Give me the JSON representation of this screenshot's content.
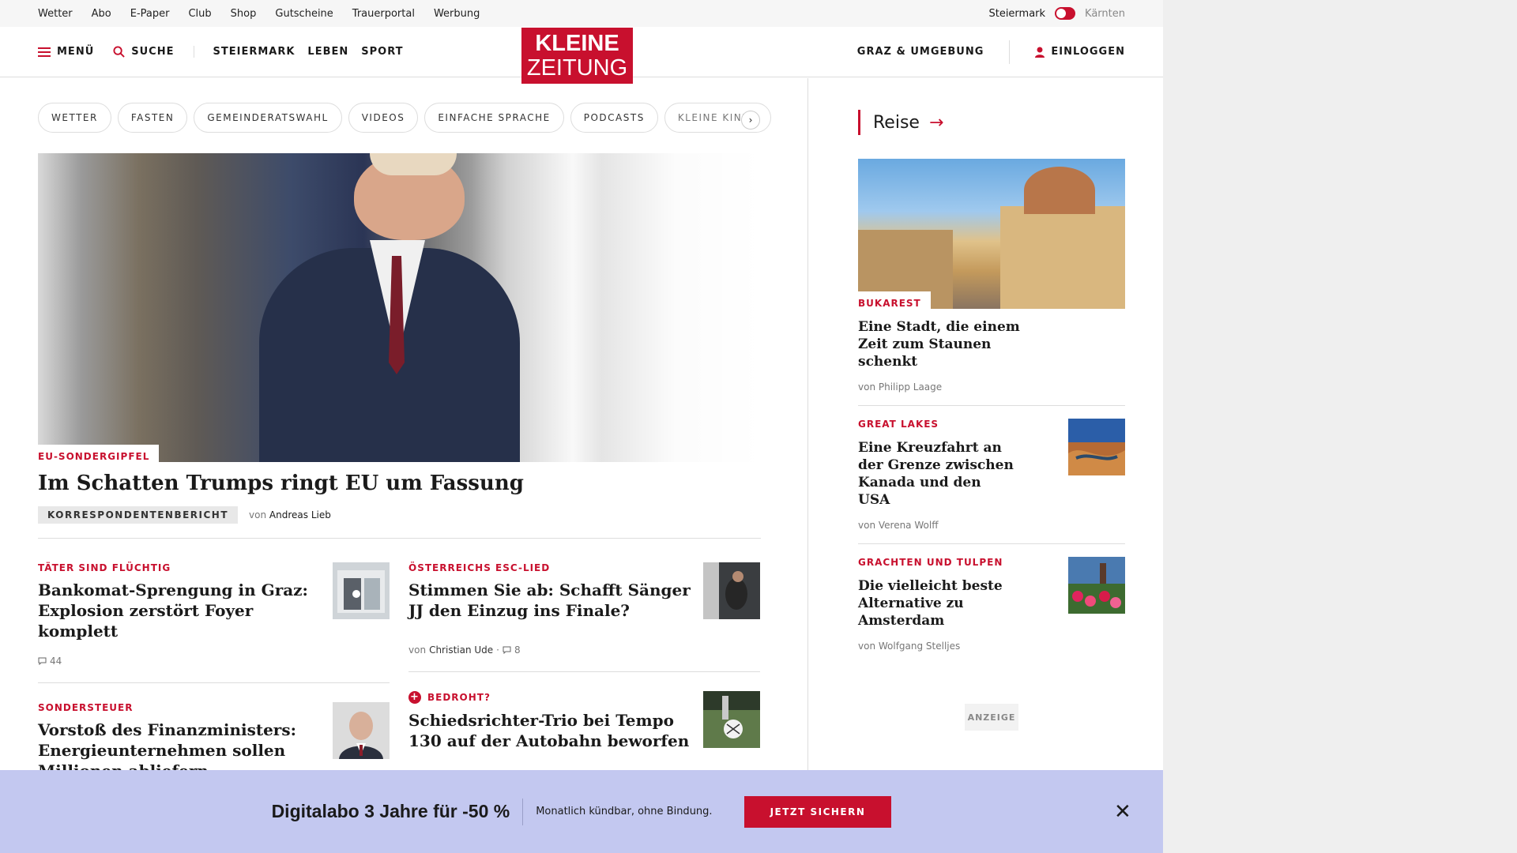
{
  "topbar": {
    "links": [
      "Wetter",
      "Abo",
      "E-Paper",
      "Club",
      "Shop",
      "Gutscheine",
      "Trauerportal",
      "Werbung"
    ],
    "region_active": "Steiermark",
    "region_inactive": "Kärnten"
  },
  "header": {
    "menu": "MENÜ",
    "search": "SUCHE",
    "nav": [
      "STEIERMARK",
      "LEBEN",
      "SPORT"
    ],
    "logo_line1": "KLEINE",
    "logo_line2": "ZEITUNG",
    "region_link": "GRAZ & UMGEBUNG",
    "login": "EINLOGGEN"
  },
  "chips": [
    "WETTER",
    "FASTEN",
    "GEMEINDERATSWAHL",
    "VIDEOS",
    "EINFACHE SPRACHE",
    "PODCASTS",
    "KLEINE KINDE"
  ],
  "hero": {
    "kicker": "EU-SONDERGIPFEL",
    "title": "Im Schatten Trumps ringt EU um Fassung",
    "badge": "KORRESPONDENTENBERICHT",
    "by_prefix": "von",
    "author": "Andreas Lieb"
  },
  "articles": {
    "a1": {
      "kicker": "TÄTER SIND FLÜCHTIG",
      "title": "Bankomat-Sprengung in Graz: Explosion zerstört Foyer komplett",
      "comments": "44"
    },
    "a2": {
      "kicker": "ÖSTERREICHS ESC-LIED",
      "title": "Stimmen Sie ab: Schafft Sänger JJ den Einzug ins Finale?",
      "by_prefix": "von",
      "author": "Christian Ude",
      "sep": "·",
      "comments": "8"
    },
    "a3": {
      "kicker": "SONDERSTEUER",
      "title": "Vorstoß des Finanzministers: Energieunternehmen sollen Millionen abliefern"
    },
    "a4": {
      "kicker": "BEDROHT?",
      "title": "Schiedsrichter-Trio bei Tempo 130 auf der Autobahn beworfen"
    }
  },
  "sidebar": {
    "heading": "Reise",
    "s1": {
      "kicker": "BUKAREST",
      "title": "Eine Stadt, die einem Zeit zum Staunen schenkt",
      "byline": "von Philipp Laage"
    },
    "s2": {
      "kicker": "GREAT LAKES",
      "title": "Eine Kreuzfahrt an der Grenze zwischen Kanada und den USA",
      "byline": "von Verena Wolff"
    },
    "s3": {
      "kicker": "GRACHTEN UND TULPEN",
      "title": "Die vielleicht beste Alternative zu Amsterdam",
      "byline": "von Wolfgang Stelljes"
    },
    "ad_label": "ANZEIGE"
  },
  "promo": {
    "headline": "Digitalabo 3 Jahre für -50 %",
    "sub": "Monatlich kündbar, ohne Bindung.",
    "cta": "JETZT SICHERN"
  },
  "colors": {
    "brand_red": "#c8102e",
    "promo_bg": "#c3c8f0"
  }
}
